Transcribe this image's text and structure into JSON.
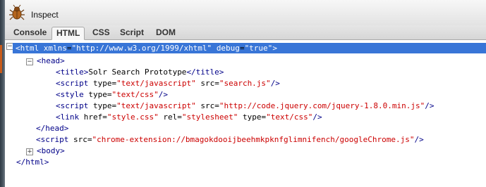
{
  "toolbar": {
    "inspect_label": "Inspect"
  },
  "tabs": [
    {
      "label": "Console"
    },
    {
      "label": "HTML"
    },
    {
      "label": "CSS"
    },
    {
      "label": "Script"
    },
    {
      "label": "DOM"
    }
  ],
  "active_tab": "HTML",
  "tree": {
    "html_open": {
      "tag": "html",
      "attr1": "xmlns",
      "val1": "\"http://www.w3.org/1999/xhtml\"",
      "attr2": "debug",
      "val2": "\"true\""
    },
    "head_open": "<head>",
    "title_line": {
      "open": "<title>",
      "text": "Solr Search Prototype",
      "close": "</title>"
    },
    "script1": {
      "attr1": "type",
      "val1": "\"text/javascript\"",
      "attr2": "src",
      "val2": "\"search.js\""
    },
    "style1": {
      "attr1": "type",
      "val1": "\"text/css\""
    },
    "script2": {
      "attr1": "type",
      "val1": "\"text/javascript\"",
      "attr2": "src",
      "val2": "\"http://code.jquery.com/jquery-1.8.0.min.js\""
    },
    "link1": {
      "attr1": "href",
      "val1": "\"style.css\"",
      "attr2": "rel",
      "val2": "\"stylesheet\"",
      "attr3": "type",
      "val3": "\"text/css\""
    },
    "head_close": "</head>",
    "script3": {
      "attr1": "src",
      "val1": "\"chrome-extension://bmagokdooijbeehmkpknfglimnifench/googleChrome.js\""
    },
    "body_collapsed": "<body>",
    "html_close": "</html>"
  },
  "colors": {
    "selection": "#3875d7",
    "tag": "#000088",
    "value": "#cc0000"
  }
}
